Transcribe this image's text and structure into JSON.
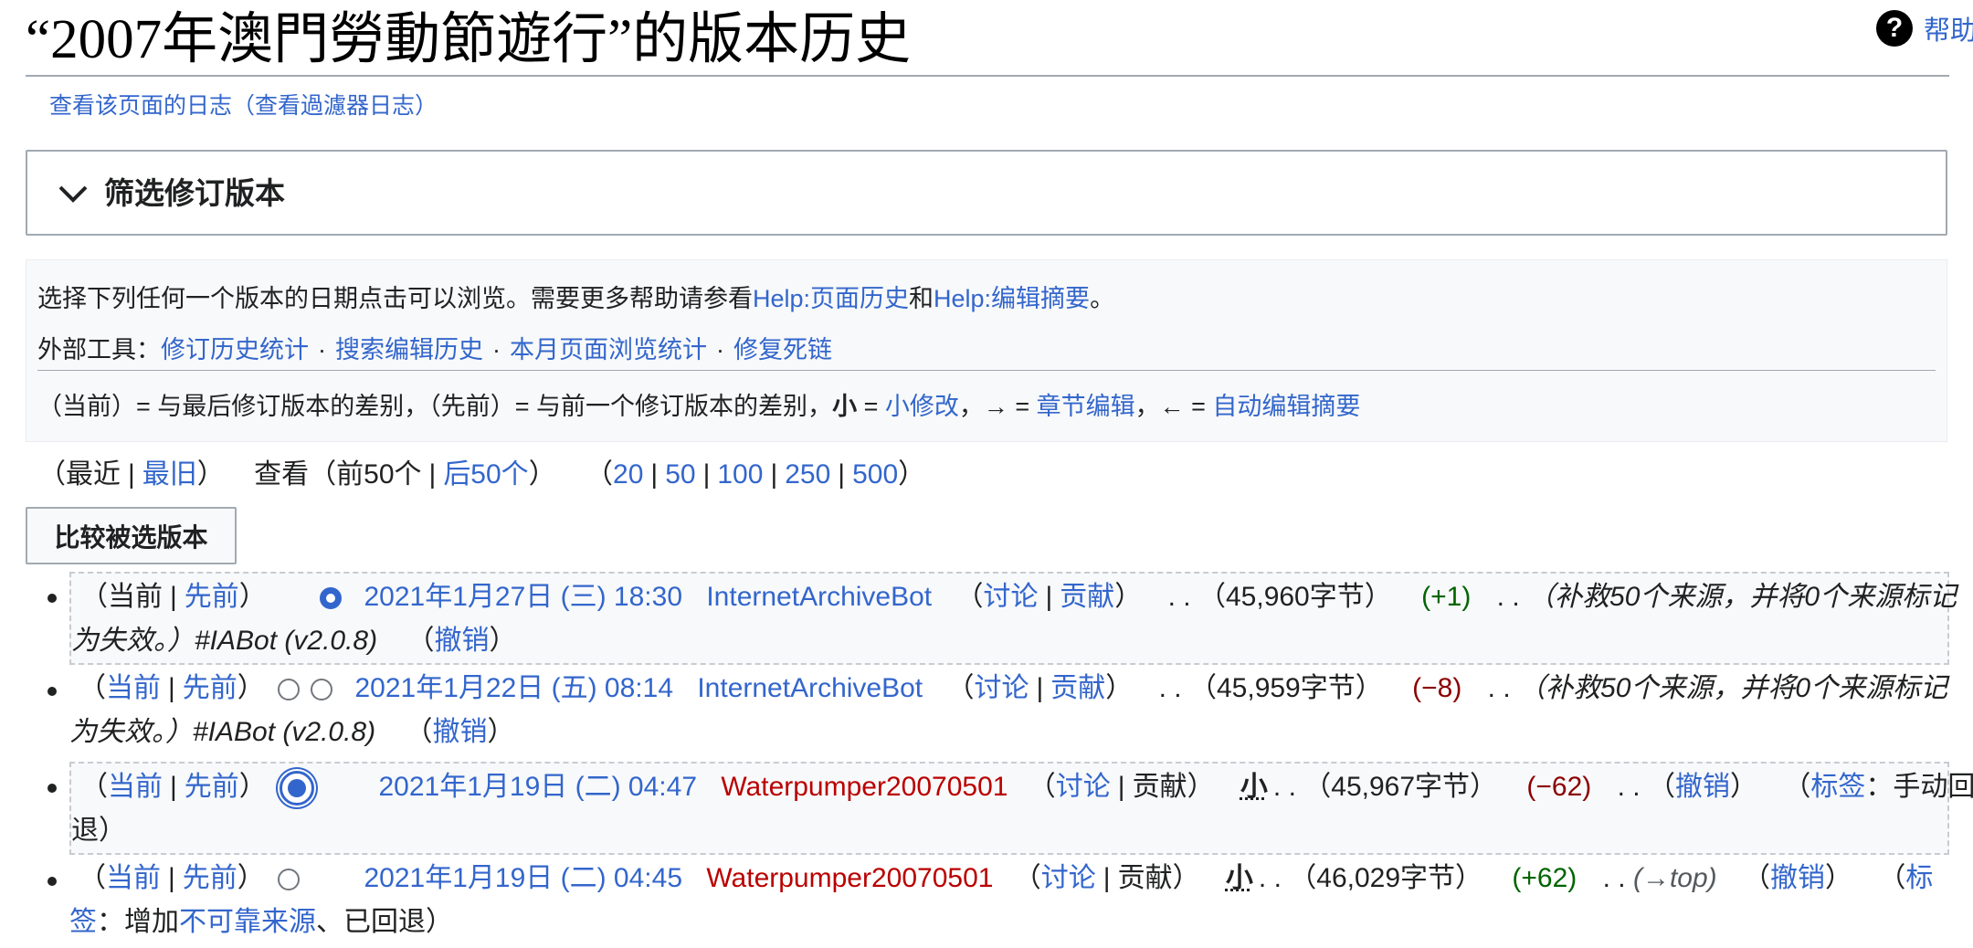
{
  "header": {
    "title": "“2007年澳門勞動節遊行”的版本历史",
    "help_label": "帮助",
    "help_icon": "question-circle-icon"
  },
  "subtitle": {
    "log_link": "查看该页面的日志",
    "filter_log_link": "（查看過濾器日志）"
  },
  "filter": {
    "title": "筛选修订版本",
    "icon": "chevron-down-icon"
  },
  "info": {
    "line1_prefix": "选择下列任何一个版本的日期点击可以浏览。需要更多帮助请参看",
    "help_history": "Help:页面历史",
    "and": "和",
    "help_summary": "Help:编辑摘要",
    "period": "。",
    "tools_prefix": "外部工具：",
    "tools": [
      "修订历史统计",
      "搜索编辑历史",
      "本月页面浏览统计",
      "修复死链"
    ],
    "legend_cur": "（当前）= 与最后修订版本的差别，",
    "legend_prev": "（先前）= 与前一个修订版本的差别，",
    "legend_minor_glyph": "小",
    "legend_eq": " = ",
    "legend_minor": "小修改",
    "legend_arrow_r": "，→ = ",
    "legend_section": "章节编辑",
    "legend_arrow_l": "，← = ",
    "legend_auto": "自动编辑摘要"
  },
  "nav": {
    "open": "（",
    "latest": "最近",
    "oldest": "最旧",
    "close": "）",
    "view": "查看（",
    "prev50": "前50个",
    "next50": "后50个",
    "close2": "）",
    "open3": "（",
    "limits": [
      "20",
      "50",
      "100",
      "250",
      "500"
    ],
    "close3": "）"
  },
  "compare_button": "比较被选版本",
  "revisions": [
    {
      "cur": "当前",
      "prev": "先前",
      "date": "2021年1月27日 (三) 18:30",
      "user": "InternetArchiveBot",
      "talk": "讨论",
      "contribs": "贡献",
      "size": "45,960字节",
      "diff": "+1",
      "summary_l1": "（补救50个来源，并将0个来源标记",
      "summary_l2": "为失效。）#IABot (v2.0.8)",
      "undo": "撤销"
    },
    {
      "cur": "当前",
      "prev": "先前",
      "date": "2021年1月22日 (五) 08:14",
      "user": "InternetArchiveBot",
      "talk": "讨论",
      "contribs": "贡献",
      "size": "45,959字节",
      "diff": "−8",
      "summary_l1": "（补救50个来源，并将0个来源标记",
      "summary_l2": "为失效。）#IABot (v2.0.8)",
      "undo": "撤销"
    },
    {
      "cur": "当前",
      "prev": "先前",
      "date": "2021年1月19日 (二) 04:47",
      "user": "Waterpumper20070501",
      "talk": "讨论",
      "contribs": "贡献",
      "minor": "小",
      "size": "45,967字节",
      "diff": "−62",
      "undo": "撤销",
      "tag_label": "标签",
      "tag_l1": "：手动回",
      "tag_l2": "退）"
    },
    {
      "cur": "当前",
      "prev": "先前",
      "date": "2021年1月19日 (二) 04:45",
      "user": "Waterpumper20070501",
      "talk": "讨论",
      "contribs": "贡献",
      "minor": "小",
      "size": "46,029字节",
      "diff": "+62",
      "summary": "(→top)",
      "undo": "撤销",
      "tag_l1_label": "标",
      "tag_l2_label": "签",
      "tag_l2_text": "：增加",
      "tag_l2_link": "不可靠来源",
      "tag_l2_rest": "、已回退）"
    }
  ]
}
